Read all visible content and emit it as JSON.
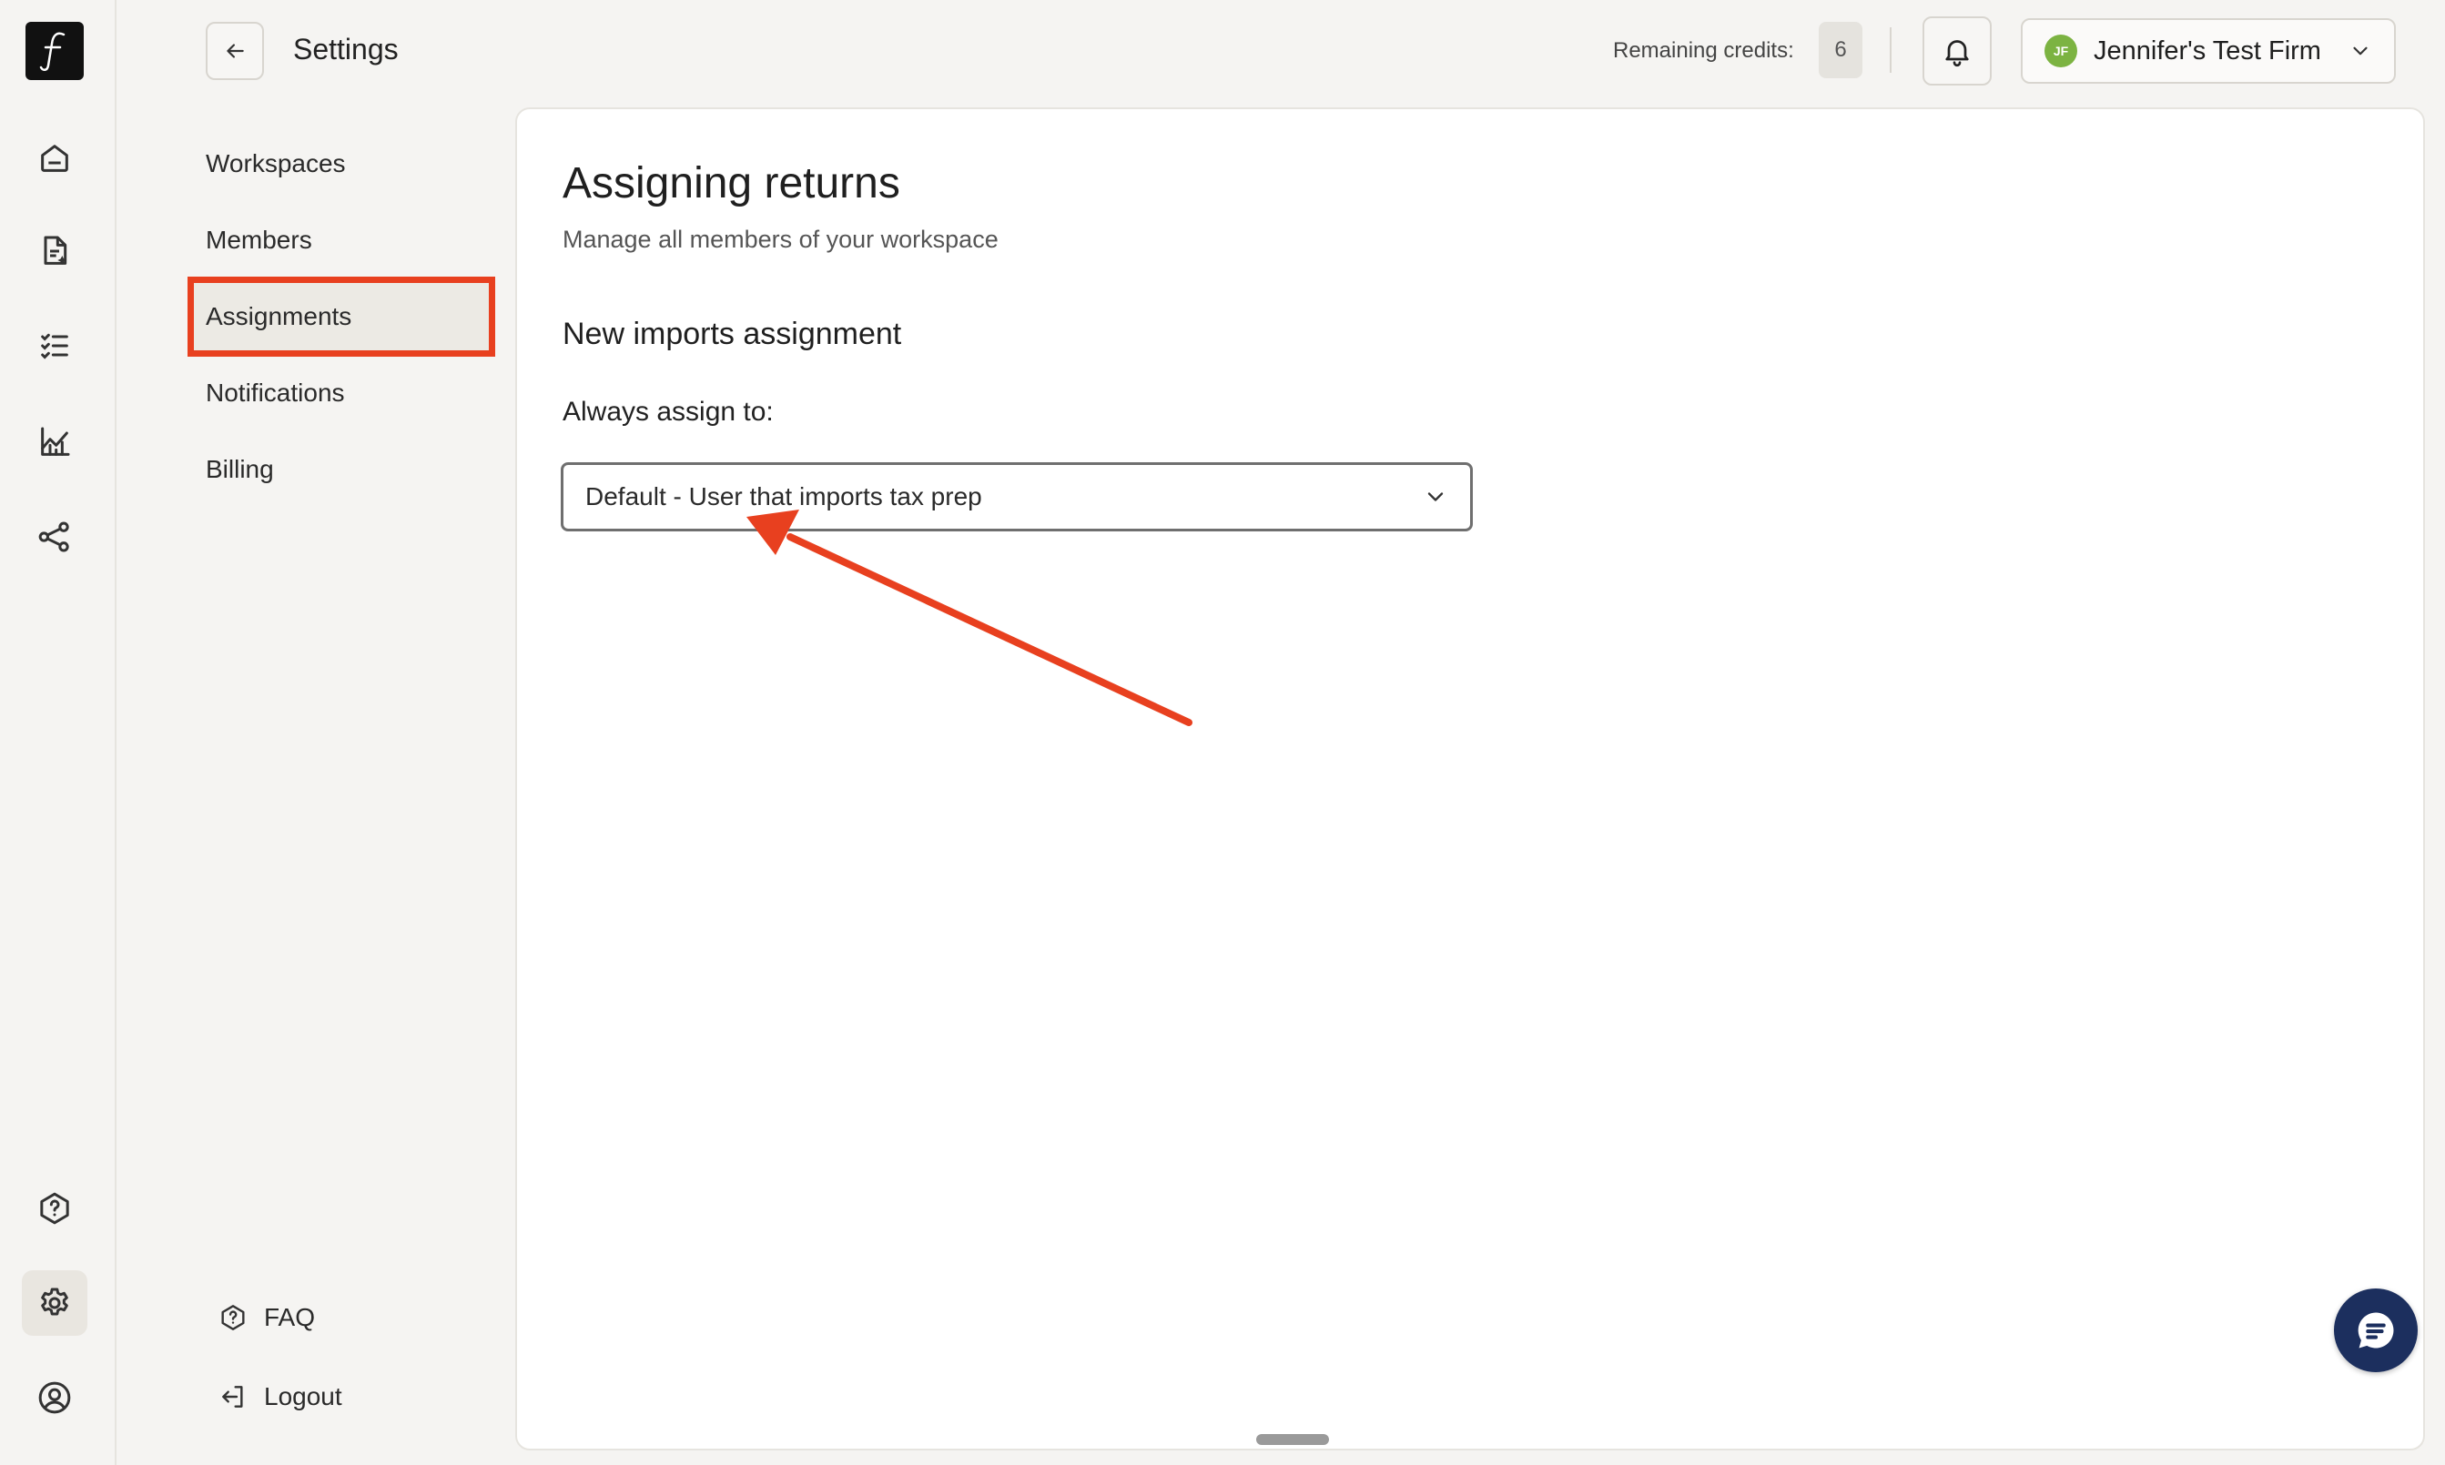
{
  "header": {
    "title": "Settings",
    "credits_label": "Remaining credits:",
    "credits_value": "6",
    "firm": {
      "initials": "JF",
      "name": "Jennifer's Test Firm"
    }
  },
  "rail": {
    "icons": [
      "logo-icon",
      "home-icon",
      "document-icon",
      "checklist-icon",
      "chart-icon",
      "share-icon",
      "help-icon",
      "settings-icon",
      "user-icon"
    ]
  },
  "subnav": {
    "items": [
      {
        "label": "Workspaces"
      },
      {
        "label": "Members"
      },
      {
        "label": "Assignments"
      },
      {
        "label": "Notifications"
      },
      {
        "label": "Billing"
      }
    ],
    "active": "Assignments",
    "faq_label": "FAQ",
    "logout_label": "Logout"
  },
  "main": {
    "title": "Assigning returns",
    "subtitle": "Manage all members of your workspace",
    "section_title": "New imports assignment",
    "field_label": "Always assign to:",
    "dropdown_value": "Default - User that imports tax prep"
  },
  "colors": {
    "accent_highlight": "#e8401f",
    "chat_button": "#1c2f5e",
    "avatar": "#7cb342"
  }
}
